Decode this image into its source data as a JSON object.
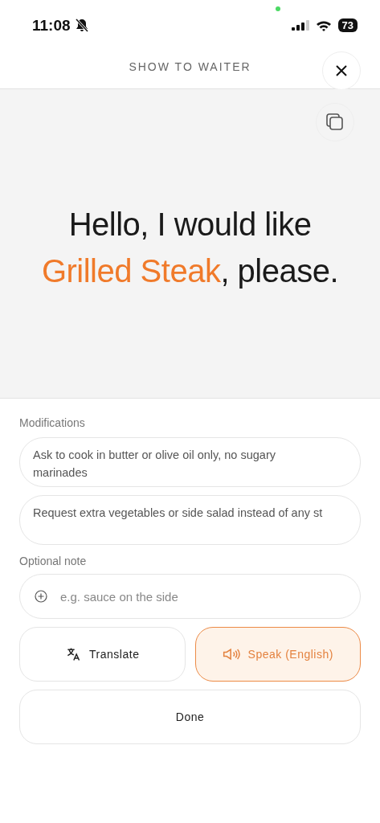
{
  "status_bar": {
    "time": "11:08",
    "battery": "73"
  },
  "header": {
    "title": "SHOW TO WAITER"
  },
  "phrase": {
    "before": "Hello, I would like ",
    "dish": "Grilled Steak",
    "after": ", please."
  },
  "modifications": {
    "label": "Modifications",
    "items": [
      {
        "value": "Ask to cook in butter or olive oil only, no sugary marinades"
      },
      {
        "value": "Request extra vegetables or side salad instead of any st"
      }
    ]
  },
  "note": {
    "label": "Optional note",
    "placeholder": "e.g. sauce on the side"
  },
  "actions": [
    {
      "kind": "translate",
      "label": "Translate",
      "highlighted": false
    },
    {
      "kind": "speak",
      "label": "Speak (English)",
      "highlighted": true
    }
  ],
  "done": {
    "label": "Done"
  }
}
